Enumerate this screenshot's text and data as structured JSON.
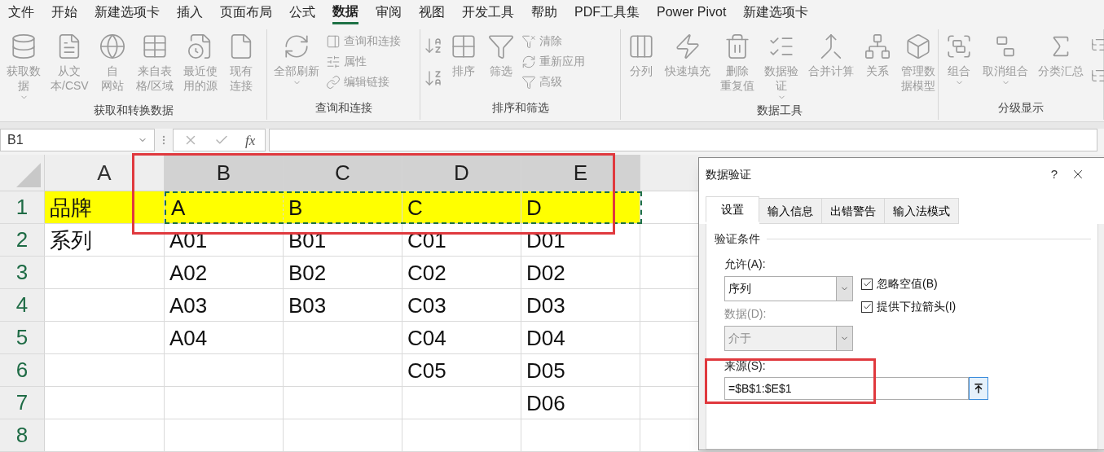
{
  "menu_tabs": [
    {
      "label": "文件",
      "selected": false
    },
    {
      "label": "开始",
      "selected": false
    },
    {
      "label": "新建选项卡",
      "selected": false
    },
    {
      "label": "插入",
      "selected": false
    },
    {
      "label": "页面布局",
      "selected": false
    },
    {
      "label": "公式",
      "selected": false
    },
    {
      "label": "数据",
      "selected": true
    },
    {
      "label": "审阅",
      "selected": false
    },
    {
      "label": "视图",
      "selected": false
    },
    {
      "label": "开发工具",
      "selected": false
    },
    {
      "label": "帮助",
      "selected": false
    },
    {
      "label": "PDF工具集",
      "selected": false
    },
    {
      "label": "Power Pivot",
      "selected": false
    },
    {
      "label": "新建选项卡",
      "selected": false
    }
  ],
  "ribbon": {
    "groups": [
      {
        "label": "获取和转换数据",
        "items": [
          {
            "kind": "large",
            "lines": [
              "获取数",
              "据"
            ],
            "dropdown": true
          },
          {
            "kind": "large",
            "lines": [
              "从文",
              "本/CSV"
            ],
            "dropdown": false
          },
          {
            "kind": "large",
            "lines": [
              "自",
              "网站"
            ],
            "dropdown": false
          },
          {
            "kind": "large",
            "lines": [
              "来自表",
              "格/区域"
            ],
            "dropdown": false
          },
          {
            "kind": "large",
            "lines": [
              "最近使",
              "用的源"
            ],
            "dropdown": false
          },
          {
            "kind": "large",
            "lines": [
              "现有",
              "连接"
            ],
            "dropdown": false
          }
        ]
      },
      {
        "label": "查询和连接",
        "items": [
          {
            "kind": "large",
            "lines": [
              "全部刷新"
            ],
            "dropdown": true
          },
          {
            "kind": "stack",
            "entries": [
              "查询和连接",
              "属性",
              "编辑链接"
            ]
          }
        ]
      },
      {
        "label": "排序和筛选",
        "items": [
          {
            "kind": "icons"
          },
          {
            "kind": "large",
            "lines": [
              "排序"
            ],
            "dropdown": false
          },
          {
            "kind": "large",
            "lines": [
              "筛选"
            ],
            "dropdown": false
          },
          {
            "kind": "stack",
            "entries": [
              "清除",
              "重新应用",
              "高级"
            ]
          }
        ]
      },
      {
        "label": "数据工具",
        "items": [
          {
            "kind": "large",
            "lines": [
              "分列"
            ],
            "dropdown": false
          },
          {
            "kind": "large",
            "lines": [
              "快速填充"
            ],
            "dropdown": false
          },
          {
            "kind": "large",
            "lines": [
              "删除",
              "重复值"
            ],
            "dropdown": false
          },
          {
            "kind": "large",
            "lines": [
              "数据验",
              "证"
            ],
            "dropdown": true
          },
          {
            "kind": "large",
            "lines": [
              "合并计算"
            ],
            "dropdown": false
          },
          {
            "kind": "large",
            "lines": [
              "关系"
            ],
            "dropdown": false
          },
          {
            "kind": "large",
            "lines": [
              "管理数",
              "据模型"
            ],
            "dropdown": false
          }
        ]
      },
      {
        "label": "分级显示",
        "items": [
          {
            "kind": "large",
            "lines": [
              "组合"
            ],
            "dropdown": true
          },
          {
            "kind": "large",
            "lines": [
              "取消组合"
            ],
            "dropdown": true
          },
          {
            "kind": "large",
            "lines": [
              "分类汇总"
            ],
            "dropdown": false
          },
          {
            "kind": "icons"
          }
        ]
      }
    ]
  },
  "formula_bar": {
    "name_box": "B1",
    "function_label": "fx"
  },
  "sheet": {
    "columns": [
      {
        "label": "A",
        "selected": false
      },
      {
        "label": "B",
        "selected": true
      },
      {
        "label": "C",
        "selected": true
      },
      {
        "label": "D",
        "selected": true
      },
      {
        "label": "E",
        "selected": true
      }
    ],
    "rows": [
      {
        "label": "1",
        "highlighted": true,
        "cells": [
          "品牌",
          "A",
          "B",
          "C",
          "D"
        ]
      },
      {
        "label": "2",
        "cells": [
          "系列",
          "A01",
          "B01",
          "C01",
          "D01"
        ]
      },
      {
        "label": "3",
        "cells": [
          null,
          "A02",
          "B02",
          "C02",
          "D02"
        ]
      },
      {
        "label": "4",
        "cells": [
          null,
          "A03",
          "B03",
          "C03",
          "D03"
        ]
      },
      {
        "label": "5",
        "cells": [
          null,
          "A04",
          null,
          "C04",
          "D04"
        ]
      },
      {
        "label": "6",
        "cells": [
          null,
          null,
          null,
          "C05",
          "D05"
        ]
      },
      {
        "label": "7",
        "cells": [
          null,
          null,
          null,
          null,
          "D06"
        ]
      },
      {
        "label": "8",
        "cells": [
          null,
          null,
          null,
          null,
          null
        ]
      }
    ]
  },
  "dialog": {
    "title": "数据验证",
    "help": "?",
    "tabs": [
      {
        "label": "设置",
        "selected": true
      },
      {
        "label": "输入信息",
        "selected": false
      },
      {
        "label": "出错警告",
        "selected": false
      },
      {
        "label": "输入法模式",
        "selected": false
      }
    ],
    "section": "验证条件",
    "allow_label": "允许(A):",
    "allow_value": "序列",
    "data_label": "数据(D):",
    "data_value": "介于",
    "data_disabled": true,
    "checkboxes": [
      {
        "label": "忽略空值(B)",
        "checked": true
      },
      {
        "label": "提供下拉箭头(I)",
        "checked": true
      }
    ],
    "source_label": "来源(S):",
    "source_value": "=$B$1:$E$1"
  }
}
